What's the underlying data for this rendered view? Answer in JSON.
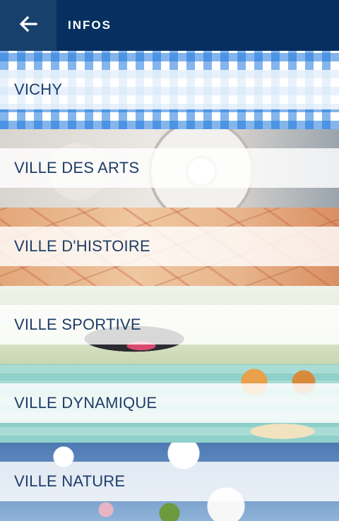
{
  "header": {
    "title": "INFOS",
    "back_icon": "arrow-left-icon"
  },
  "colors": {
    "header_bg": "#05305f",
    "back_button_bg": "#17406c",
    "label_text": "#1f3d66"
  },
  "items": [
    {
      "label": "VICHY",
      "background": "blue-gingham-pattern"
    },
    {
      "label": "VILLE DES ARTS",
      "background": "compass-sculpture"
    },
    {
      "label": "VILLE D'HISTOIRE",
      "background": "old-map"
    },
    {
      "label": "VILLE SPORTIVE",
      "background": "running-shoe"
    },
    {
      "label": "VILLE DYNAMIQUE",
      "background": "spa-products"
    },
    {
      "label": "VILLE NATURE",
      "background": "apple-blossom"
    }
  ]
}
